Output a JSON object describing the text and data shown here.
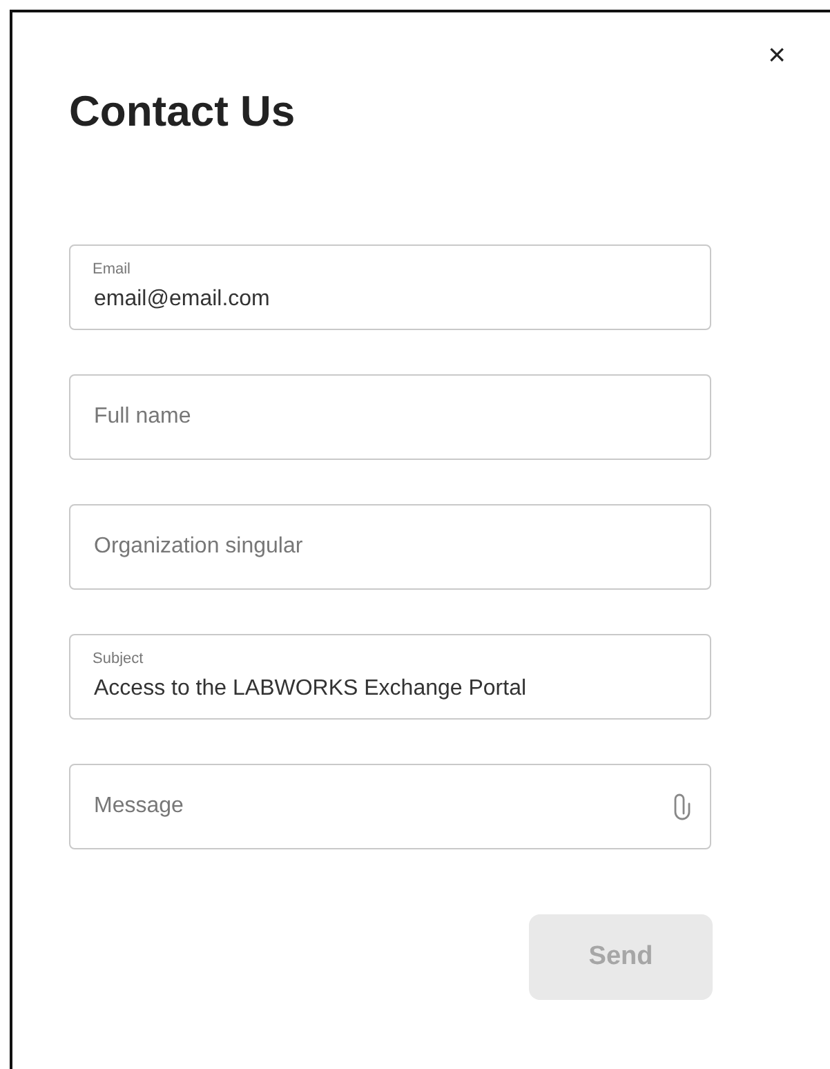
{
  "dialog": {
    "title": "Contact Us",
    "close": "×"
  },
  "fields": [
    {
      "kind": "text",
      "label": "Email",
      "value": "email@email.com"
    },
    {
      "kind": "text",
      "placeholder": "Full name"
    },
    {
      "kind": "text",
      "placeholder": "Organization singular"
    },
    {
      "kind": "text",
      "label": "Subject",
      "value": "Access to the LABWORKS Exchange Portal"
    },
    {
      "kind": "attachable",
      "placeholder": "Message"
    }
  ],
  "submit": {
    "label": "Send",
    "disabled": true
  }
}
